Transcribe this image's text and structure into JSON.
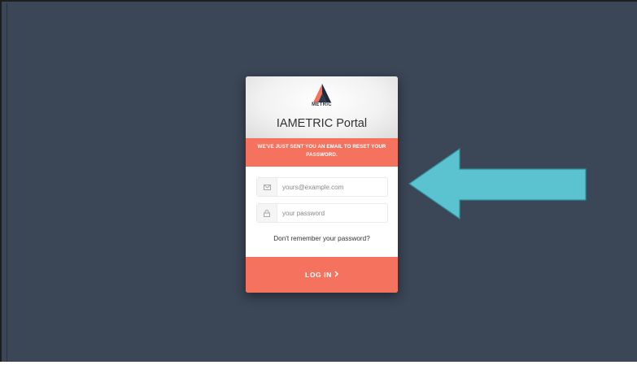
{
  "card": {
    "logo_text": "METRIC",
    "title": "IAMETRIC Portal",
    "alert": "WE'VE JUST SENT YOU AN EMAIL TO RESET YOUR PASSWORD.",
    "email_placeholder": "yours@example.com",
    "password_placeholder": "your password",
    "forgot_link": "Don't remember your password?",
    "login_label": "LOG IN"
  },
  "icons": {
    "email": "email-icon",
    "password": "lock-icon",
    "login_chevron": "chevron-right-icon",
    "annotation": "arrow-left-icon"
  },
  "colors": {
    "background": "#3b4656",
    "accent": "#f5725f",
    "annotation_arrow": "#5bc3cf"
  }
}
